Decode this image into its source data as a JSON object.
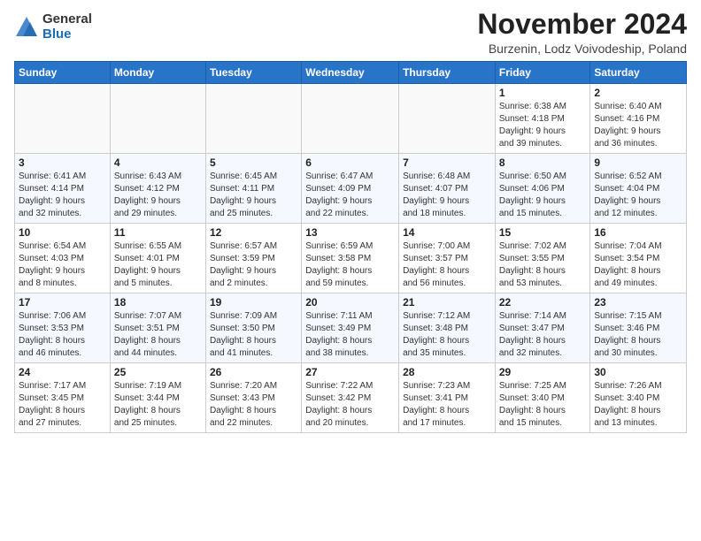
{
  "header": {
    "logo_general": "General",
    "logo_blue": "Blue",
    "month_title": "November 2024",
    "subtitle": "Burzenin, Lodz Voivodeship, Poland"
  },
  "days_of_week": [
    "Sunday",
    "Monday",
    "Tuesday",
    "Wednesday",
    "Thursday",
    "Friday",
    "Saturday"
  ],
  "weeks": [
    [
      {
        "day": "",
        "info": ""
      },
      {
        "day": "",
        "info": ""
      },
      {
        "day": "",
        "info": ""
      },
      {
        "day": "",
        "info": ""
      },
      {
        "day": "",
        "info": ""
      },
      {
        "day": "1",
        "info": "Sunrise: 6:38 AM\nSunset: 4:18 PM\nDaylight: 9 hours\nand 39 minutes."
      },
      {
        "day": "2",
        "info": "Sunrise: 6:40 AM\nSunset: 4:16 PM\nDaylight: 9 hours\nand 36 minutes."
      }
    ],
    [
      {
        "day": "3",
        "info": "Sunrise: 6:41 AM\nSunset: 4:14 PM\nDaylight: 9 hours\nand 32 minutes."
      },
      {
        "day": "4",
        "info": "Sunrise: 6:43 AM\nSunset: 4:12 PM\nDaylight: 9 hours\nand 29 minutes."
      },
      {
        "day": "5",
        "info": "Sunrise: 6:45 AM\nSunset: 4:11 PM\nDaylight: 9 hours\nand 25 minutes."
      },
      {
        "day": "6",
        "info": "Sunrise: 6:47 AM\nSunset: 4:09 PM\nDaylight: 9 hours\nand 22 minutes."
      },
      {
        "day": "7",
        "info": "Sunrise: 6:48 AM\nSunset: 4:07 PM\nDaylight: 9 hours\nand 18 minutes."
      },
      {
        "day": "8",
        "info": "Sunrise: 6:50 AM\nSunset: 4:06 PM\nDaylight: 9 hours\nand 15 minutes."
      },
      {
        "day": "9",
        "info": "Sunrise: 6:52 AM\nSunset: 4:04 PM\nDaylight: 9 hours\nand 12 minutes."
      }
    ],
    [
      {
        "day": "10",
        "info": "Sunrise: 6:54 AM\nSunset: 4:03 PM\nDaylight: 9 hours\nand 8 minutes."
      },
      {
        "day": "11",
        "info": "Sunrise: 6:55 AM\nSunset: 4:01 PM\nDaylight: 9 hours\nand 5 minutes."
      },
      {
        "day": "12",
        "info": "Sunrise: 6:57 AM\nSunset: 3:59 PM\nDaylight: 9 hours\nand 2 minutes."
      },
      {
        "day": "13",
        "info": "Sunrise: 6:59 AM\nSunset: 3:58 PM\nDaylight: 8 hours\nand 59 minutes."
      },
      {
        "day": "14",
        "info": "Sunrise: 7:00 AM\nSunset: 3:57 PM\nDaylight: 8 hours\nand 56 minutes."
      },
      {
        "day": "15",
        "info": "Sunrise: 7:02 AM\nSunset: 3:55 PM\nDaylight: 8 hours\nand 53 minutes."
      },
      {
        "day": "16",
        "info": "Sunrise: 7:04 AM\nSunset: 3:54 PM\nDaylight: 8 hours\nand 49 minutes."
      }
    ],
    [
      {
        "day": "17",
        "info": "Sunrise: 7:06 AM\nSunset: 3:53 PM\nDaylight: 8 hours\nand 46 minutes."
      },
      {
        "day": "18",
        "info": "Sunrise: 7:07 AM\nSunset: 3:51 PM\nDaylight: 8 hours\nand 44 minutes."
      },
      {
        "day": "19",
        "info": "Sunrise: 7:09 AM\nSunset: 3:50 PM\nDaylight: 8 hours\nand 41 minutes."
      },
      {
        "day": "20",
        "info": "Sunrise: 7:11 AM\nSunset: 3:49 PM\nDaylight: 8 hours\nand 38 minutes."
      },
      {
        "day": "21",
        "info": "Sunrise: 7:12 AM\nSunset: 3:48 PM\nDaylight: 8 hours\nand 35 minutes."
      },
      {
        "day": "22",
        "info": "Sunrise: 7:14 AM\nSunset: 3:47 PM\nDaylight: 8 hours\nand 32 minutes."
      },
      {
        "day": "23",
        "info": "Sunrise: 7:15 AM\nSunset: 3:46 PM\nDaylight: 8 hours\nand 30 minutes."
      }
    ],
    [
      {
        "day": "24",
        "info": "Sunrise: 7:17 AM\nSunset: 3:45 PM\nDaylight: 8 hours\nand 27 minutes."
      },
      {
        "day": "25",
        "info": "Sunrise: 7:19 AM\nSunset: 3:44 PM\nDaylight: 8 hours\nand 25 minutes."
      },
      {
        "day": "26",
        "info": "Sunrise: 7:20 AM\nSunset: 3:43 PM\nDaylight: 8 hours\nand 22 minutes."
      },
      {
        "day": "27",
        "info": "Sunrise: 7:22 AM\nSunset: 3:42 PM\nDaylight: 8 hours\nand 20 minutes."
      },
      {
        "day": "28",
        "info": "Sunrise: 7:23 AM\nSunset: 3:41 PM\nDaylight: 8 hours\nand 17 minutes."
      },
      {
        "day": "29",
        "info": "Sunrise: 7:25 AM\nSunset: 3:40 PM\nDaylight: 8 hours\nand 15 minutes."
      },
      {
        "day": "30",
        "info": "Sunrise: 7:26 AM\nSunset: 3:40 PM\nDaylight: 8 hours\nand 13 minutes."
      }
    ]
  ]
}
